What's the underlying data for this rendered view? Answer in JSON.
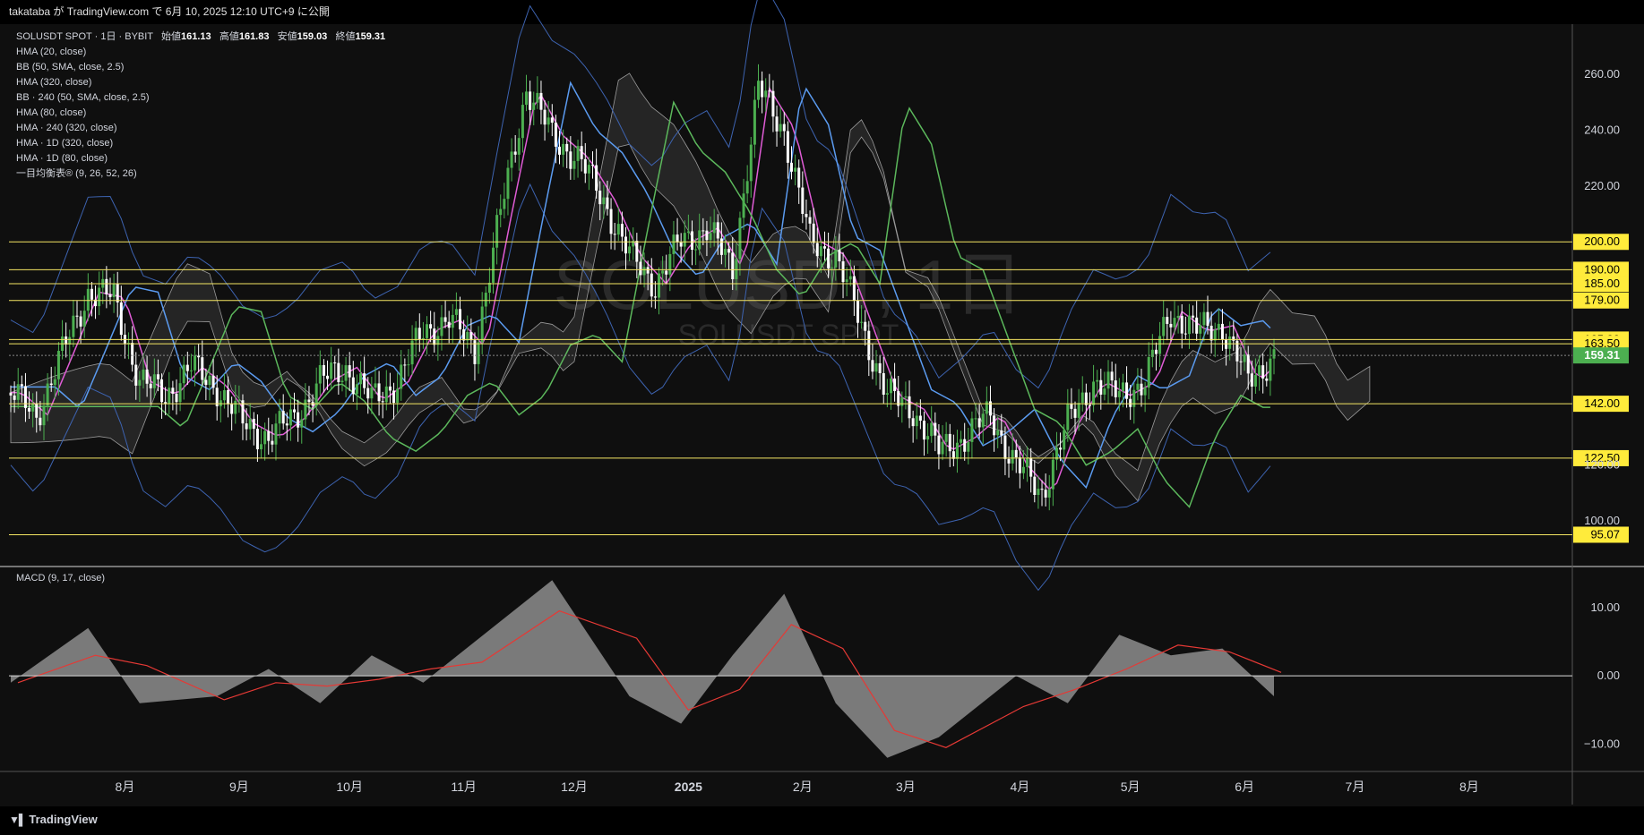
{
  "header": {
    "publish_text": "takataba が TradingView.com で 6月 10, 2025 12:10 UTC+9 に公開"
  },
  "legend": {
    "symbol": "SOLUSDT SPOT · 1日 · BYBIT",
    "open_label": "始値",
    "open": "161.13",
    "high_label": "高値",
    "high": "161.83",
    "low_label": "安値",
    "low": "159.03",
    "close_label": "終値",
    "close": "159.31",
    "indicators": [
      "HMA (20, close)",
      "BB (50, SMA, close, 2.5)",
      "HMA (320, close)",
      "BB · 240 (50, SMA, close, 2.5)",
      "HMA (80, close)",
      "HMA · 240 (320, close)",
      "HMA · 1D (320, close)",
      "HMA · 1D (80, close)",
      "一目均衡表® (9, 26, 52, 26)"
    ]
  },
  "watermark": {
    "main": "SOLUSDT, 1日",
    "sub": "SOLUSDT SPOT"
  },
  "macd_legend": "MACD (9, 17, close)",
  "footer": {
    "brand": "TradingView"
  },
  "colors": {
    "bg": "#0f0f0f",
    "up": "#4caf50",
    "down": "#ffffff",
    "hma20": "#e05cd6",
    "hma_blue": "#5b9bf0",
    "hma_green": "#5cb85c",
    "bb": "#3d63b0",
    "level": "#f5e663",
    "label_bg": "#ffeb3b",
    "price_bg": "#4caf50",
    "macd_hist": "#7a7a7a",
    "macd_signal": "#e53935"
  },
  "chart_data": [
    {
      "type": "candlestick",
      "y_axis": {
        "ylim": [
          84,
          278
        ],
        "ticks": [
          "100.00",
          "120.00",
          "220.00",
          "240.00",
          "260.00"
        ]
      },
      "x_axis": {
        "labels": [
          "8月",
          "9月",
          "10月",
          "11月",
          "12月",
          "2025",
          "2月",
          "3月",
          "4月",
          "5月",
          "6月",
          "7月",
          "8月"
        ]
      },
      "levels": [
        "200.00",
        "190.00",
        "185.00",
        "179.00",
        "165.00",
        "163.50",
        "142.00",
        "122.50",
        "95.07"
      ],
      "current_price": "159.31",
      "series": [
        {
          "name": "SOLUSDT",
          "points": [
            {
              "date": "2024-07-01",
              "value": 146
            },
            {
              "date": "2024-07-08",
              "value": 138
            },
            {
              "date": "2024-07-15",
              "value": 160
            },
            {
              "date": "2024-07-22",
              "value": 182
            },
            {
              "date": "2024-07-29",
              "value": 180
            },
            {
              "date": "2024-08-05",
              "value": 150
            },
            {
              "date": "2024-08-12",
              "value": 145
            },
            {
              "date": "2024-08-19",
              "value": 155
            },
            {
              "date": "2024-08-26",
              "value": 148
            },
            {
              "date": "2024-09-02",
              "value": 135
            },
            {
              "date": "2024-09-09",
              "value": 130
            },
            {
              "date": "2024-09-16",
              "value": 137
            },
            {
              "date": "2024-09-23",
              "value": 150
            },
            {
              "date": "2024-09-30",
              "value": 155
            },
            {
              "date": "2024-10-07",
              "value": 143
            },
            {
              "date": "2024-10-14",
              "value": 150
            },
            {
              "date": "2024-10-21",
              "value": 168
            },
            {
              "date": "2024-10-28",
              "value": 172
            },
            {
              "date": "2024-11-04",
              "value": 162
            },
            {
              "date": "2024-11-11",
              "value": 210
            },
            {
              "date": "2024-11-18",
              "value": 255
            },
            {
              "date": "2024-11-25",
              "value": 238
            },
            {
              "date": "2024-12-02",
              "value": 230
            },
            {
              "date": "2024-12-09",
              "value": 215
            },
            {
              "date": "2024-12-16",
              "value": 195
            },
            {
              "date": "2024-12-23",
              "value": 185
            },
            {
              "date": "2024-12-30",
              "value": 200
            },
            {
              "date": "2025-01-06",
              "value": 205
            },
            {
              "date": "2025-01-13",
              "value": 190
            },
            {
              "date": "2025-01-20",
              "value": 255
            },
            {
              "date": "2025-01-27",
              "value": 240
            },
            {
              "date": "2025-02-03",
              "value": 200
            },
            {
              "date": "2025-02-10",
              "value": 195
            },
            {
              "date": "2025-02-17",
              "value": 170
            },
            {
              "date": "2025-02-24",
              "value": 145
            },
            {
              "date": "2025-03-03",
              "value": 140
            },
            {
              "date": "2025-03-10",
              "value": 125
            },
            {
              "date": "2025-03-17",
              "value": 130
            },
            {
              "date": "2025-03-24",
              "value": 138
            },
            {
              "date": "2025-03-31",
              "value": 120
            },
            {
              "date": "2025-04-07",
              "value": 110
            },
            {
              "date": "2025-04-14",
              "value": 135
            },
            {
              "date": "2025-04-21",
              "value": 150
            },
            {
              "date": "2025-04-28",
              "value": 145
            },
            {
              "date": "2025-05-05",
              "value": 150
            },
            {
              "date": "2025-05-12",
              "value": 175
            },
            {
              "date": "2025-05-19",
              "value": 168
            },
            {
              "date": "2025-05-26",
              "value": 170
            },
            {
              "date": "2025-06-02",
              "value": 150
            },
            {
              "date": "2025-06-09",
              "value": 159.31
            }
          ]
        }
      ]
    },
    {
      "type": "bar",
      "title": "MACD (9, 17, close)",
      "y_axis": {
        "ylim": [
          -14,
          16
        ],
        "ticks": [
          "10.00",
          "0.00",
          "−10.00"
        ]
      },
      "series": [
        {
          "name": "MACD",
          "points": [
            {
              "date": "2024-07-01",
              "value": -1
            },
            {
              "date": "2024-07-22",
              "value": 7
            },
            {
              "date": "2024-08-05",
              "value": -4
            },
            {
              "date": "2024-08-26",
              "value": -3
            },
            {
              "date": "2024-09-09",
              "value": 1
            },
            {
              "date": "2024-09-23",
              "value": -4
            },
            {
              "date": "2024-10-07",
              "value": 3
            },
            {
              "date": "2024-10-21",
              "value": -1
            },
            {
              "date": "2024-11-04",
              "value": 5
            },
            {
              "date": "2024-11-25",
              "value": 14
            },
            {
              "date": "2024-12-16",
              "value": -3
            },
            {
              "date": "2024-12-30",
              "value": -7
            },
            {
              "date": "2025-01-13",
              "value": 3
            },
            {
              "date": "2025-01-27",
              "value": 12
            },
            {
              "date": "2025-02-10",
              "value": -4
            },
            {
              "date": "2025-02-24",
              "value": -12
            },
            {
              "date": "2025-03-10",
              "value": -9
            },
            {
              "date": "2025-03-31",
              "value": 0
            },
            {
              "date": "2025-04-14",
              "value": -4
            },
            {
              "date": "2025-04-28",
              "value": 6
            },
            {
              "date": "2025-05-12",
              "value": 3
            },
            {
              "date": "2025-05-26",
              "value": 4
            },
            {
              "date": "2025-06-09",
              "value": -3
            }
          ]
        }
      ]
    }
  ]
}
